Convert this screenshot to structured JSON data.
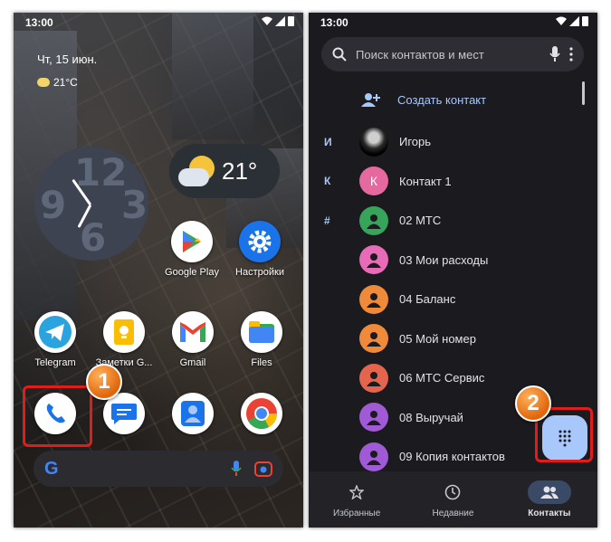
{
  "home": {
    "status_time": "13:00",
    "date": "Чт, 15 июн.",
    "small_temp": "21°C",
    "weather_temp": "21°",
    "clock_numbers": [
      "12",
      "9",
      "3",
      "6"
    ],
    "apps": [
      {
        "label": "Google Play",
        "icon": "google-play-icon",
        "color": "#ffffff"
      },
      {
        "label": "Настройки",
        "icon": "settings-gear-icon",
        "color": "#1a73e8"
      },
      {
        "label": "Telegram",
        "icon": "telegram-icon",
        "color": "#ffffff"
      },
      {
        "label": "Заметки G...",
        "icon": "keep-notes-icon",
        "color": "#ffffff"
      },
      {
        "label": "Gmail",
        "icon": "gmail-icon",
        "color": "#ffffff"
      },
      {
        "label": "Files",
        "icon": "files-icon",
        "color": "#ffffff"
      }
    ],
    "dock": [
      {
        "name": "phone-icon"
      },
      {
        "name": "messages-icon"
      },
      {
        "name": "contacts-icon"
      },
      {
        "name": "chrome-icon"
      }
    ],
    "badge_1": "1"
  },
  "contacts": {
    "status_time": "13:00",
    "search_placeholder": "Поиск контактов и мест",
    "create_label": "Создать контакт",
    "rows": [
      {
        "index": "И",
        "name": "Игорь",
        "avatar_letter": "",
        "avatar_color": "#000000",
        "photo": true
      },
      {
        "index": "К",
        "name": "Контакт 1",
        "avatar_letter": "К",
        "avatar_color": "#e5689e"
      },
      {
        "index": "#",
        "name": "02 МТС",
        "avatar_letter": "",
        "avatar_color": "#37a45b"
      },
      {
        "index": "",
        "name": "03 Мои расходы",
        "avatar_letter": "",
        "avatar_color": "#e76bb6"
      },
      {
        "index": "",
        "name": "04 Баланс",
        "avatar_letter": "",
        "avatar_color": "#ef8a3b"
      },
      {
        "index": "",
        "name": "05 Мой номер",
        "avatar_letter": "",
        "avatar_color": "#ef8a3b"
      },
      {
        "index": "",
        "name": "06 МТС Сервис",
        "avatar_letter": "",
        "avatar_color": "#e3654e"
      },
      {
        "index": "",
        "name": "08 Выручай",
        "avatar_letter": "",
        "avatar_color": "#a05ad6"
      },
      {
        "index": "",
        "name": "09 Копия контактов",
        "avatar_letter": "",
        "avatar_color": "#a05ad6"
      }
    ],
    "nav": [
      {
        "label": "Избранные",
        "icon": "star-icon",
        "active": false
      },
      {
        "label": "Недавние",
        "icon": "clock-icon",
        "active": false
      },
      {
        "label": "Контакты",
        "icon": "contacts-people-icon",
        "active": true
      }
    ],
    "badge_2": "2"
  }
}
